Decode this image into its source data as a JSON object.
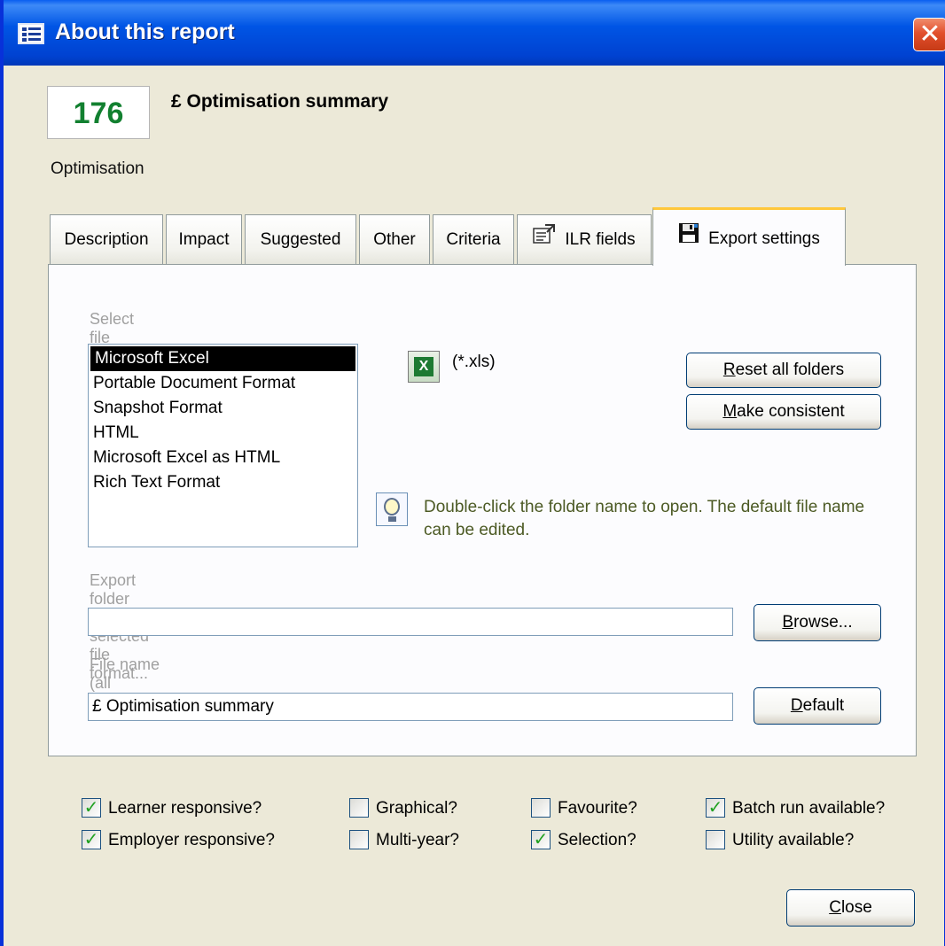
{
  "window": {
    "title": "About this report",
    "close_glyph": "✕"
  },
  "report": {
    "number": "176",
    "title": "£ Optimisation summary",
    "category": "Optimisation"
  },
  "tabs": [
    {
      "label": "Description",
      "active": false
    },
    {
      "label": "Impact",
      "active": false
    },
    {
      "label": "Suggested",
      "active": false
    },
    {
      "label": "Other",
      "active": false
    },
    {
      "label": "Criteria",
      "active": false
    },
    {
      "label": "ILR fields",
      "active": false,
      "icon": "ilr-fields-icon"
    },
    {
      "label": "Export settings",
      "active": true,
      "icon": "floppy-disk-icon"
    }
  ],
  "export": {
    "select_format_label": "Select file format...",
    "formats": [
      "Microsoft Excel",
      "Portable Document Format",
      "Snapshot Format",
      "HTML",
      "Microsoft Excel as HTML",
      "Rich Text Format"
    ],
    "selected_format": "Microsoft Excel",
    "extension": "(*.xls)",
    "extension_icon": "excel-icon",
    "reset_button": {
      "accel": "R",
      "rest": "eset all folders"
    },
    "consistent_button": {
      "accel": "M",
      "rest": "ake consistent"
    },
    "tip_text": "Double-click the folder name to open. The default file name can be edited.",
    "tip_icon": "lightbulb-icon",
    "folder_label": "Export folder for selected file format...",
    "folder_value": "",
    "browse_button": {
      "accel": "B",
      "rest": "rowse..."
    },
    "filename_label": "File name (all formats)...",
    "filename_value": "£ Optimisation summary",
    "default_button": {
      "accel": "D",
      "rest": "efault"
    }
  },
  "flags": [
    {
      "label": "Learner responsive?",
      "checked": true
    },
    {
      "label": "Employer responsive?",
      "checked": true
    },
    {
      "label": "Graphical?",
      "checked": false
    },
    {
      "label": "Multi-year?",
      "checked": false
    },
    {
      "label": "Favourite?",
      "checked": false
    },
    {
      "label": "Selection?",
      "checked": true
    },
    {
      "label": "Batch run available?",
      "checked": true
    },
    {
      "label": "Utility available?",
      "checked": false
    }
  ],
  "check_glyph": "✓",
  "close_button": {
    "accel": "C",
    "rest": "lose"
  }
}
